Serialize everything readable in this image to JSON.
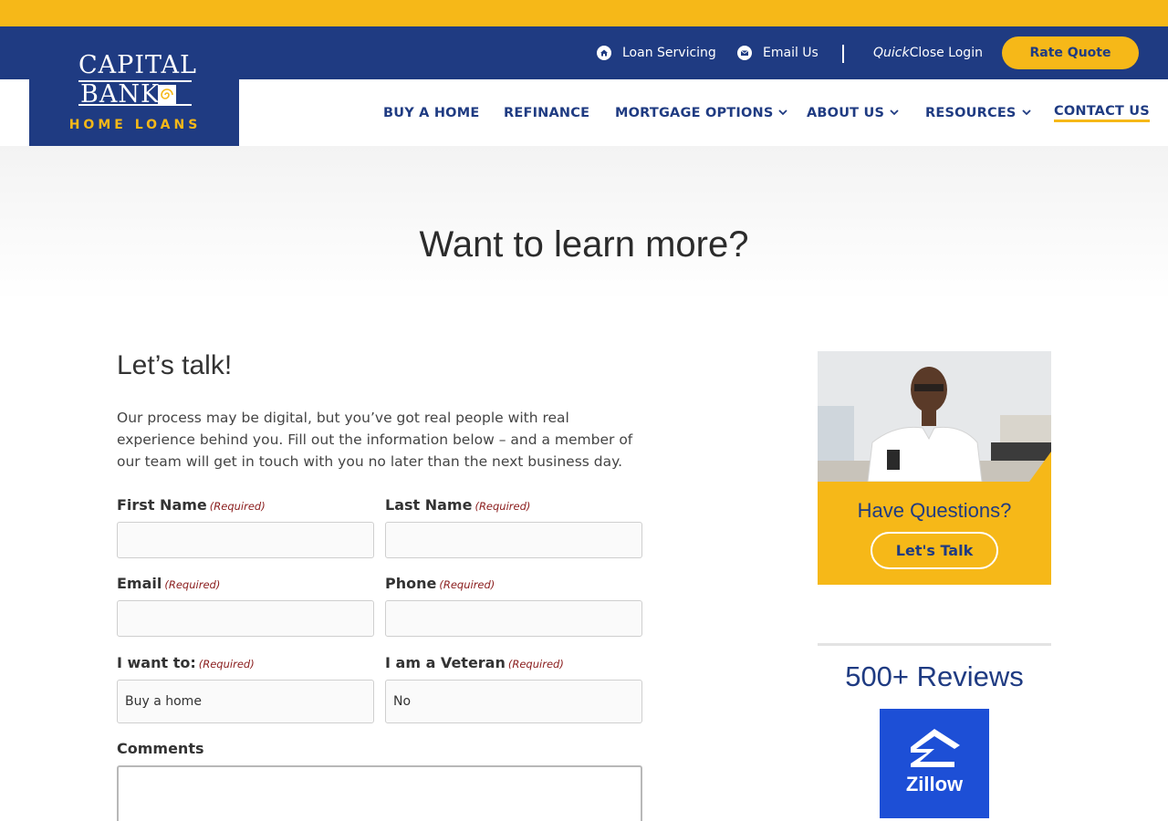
{
  "brand": {
    "line1": "CAPITAL",
    "line2": "BANK",
    "subtitle": "HOME LOANS",
    "colors": {
      "navy": "#1f3b82",
      "gold": "#f6b818"
    }
  },
  "utility_nav": {
    "loan_servicing": "Loan Servicing",
    "email_us": "Email Us",
    "quick": "Quick",
    "close_login": "Close Login",
    "rate_quote": "Rate Quote"
  },
  "main_nav": {
    "buy_home": "BUY A HOME",
    "refinance": "REFINANCE",
    "mortgage_options": "MORTGAGE OPTIONS",
    "about_us": "ABOUT US",
    "resources": "RESOURCES",
    "contact_us": "CONTACT US"
  },
  "hero": {
    "title": "Want to learn more?"
  },
  "form": {
    "heading": "Let’s talk!",
    "intro": "Our process may be digital, but you’ve got real people with real experience behind you.  Fill out the information below – and a member of our team will get in touch with you no later than the next business day.",
    "required_text": "(Required)",
    "first_name_label": "First Name",
    "last_name_label": "Last Name",
    "email_label": "Email",
    "phone_label": "Phone",
    "want_to_label": "I want to:",
    "want_to_value": "Buy a home",
    "veteran_label": "I am a Veteran",
    "veteran_value": "No",
    "comments_label": "Comments"
  },
  "sidebar": {
    "question": "Have Questions?",
    "cta": "Let's Talk",
    "reviews_title": "500+ Reviews",
    "zillow_label": "Zillow"
  },
  "icons": [
    "home-icon",
    "mail-icon",
    "chevron-down-icon",
    "zillow-logo-icon"
  ]
}
